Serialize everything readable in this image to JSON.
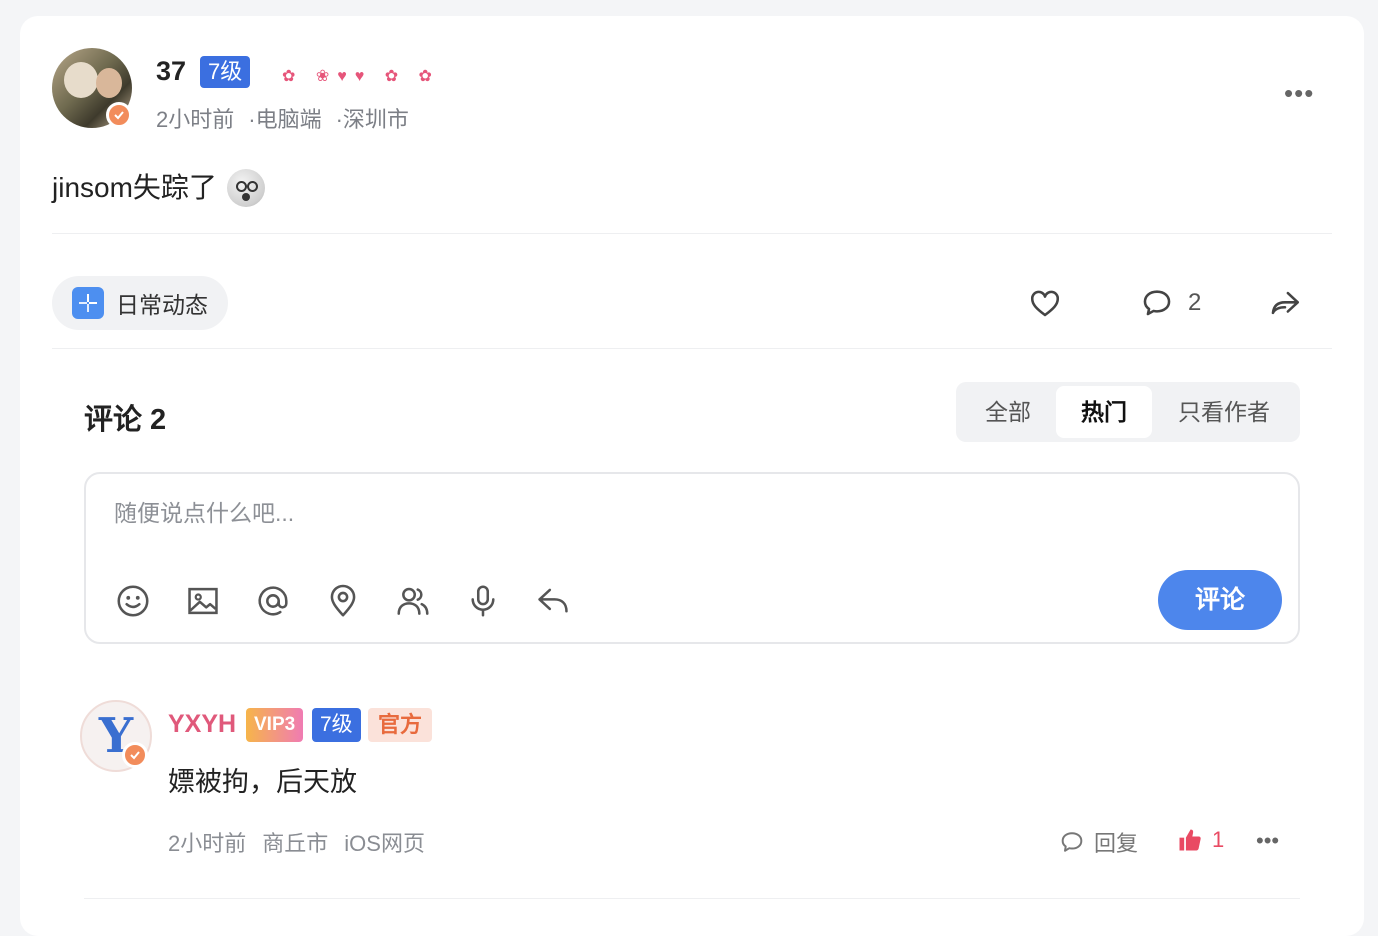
{
  "post": {
    "author": "37",
    "level": "7级",
    "decoration": "✿ ❀♥♥ ✿ ✿",
    "time": "2小时前",
    "device": "电脑端",
    "city": "深圳市",
    "separator": "·",
    "more": "•••",
    "content": "jinsom失踪了",
    "topic": "日常动态",
    "comment_count": "2"
  },
  "comments": {
    "title": "评论 2",
    "tabs": [
      "全部",
      "热门",
      "只看作者"
    ],
    "active_tab": "热门",
    "placeholder": "随便说点什么吧...",
    "submit": "评论",
    "toolbar_icons": [
      "emoji-icon",
      "image-icon",
      "at-icon",
      "location-icon",
      "users-icon",
      "microphone-icon",
      "reply-icon"
    ],
    "items": [
      {
        "avatar_letter": "Y",
        "name": "YXYH",
        "vip": "VIP3",
        "level": "7级",
        "badge": "官方",
        "text": "嫖被拘，后天放",
        "time": "2小时前",
        "city": "商丘市",
        "device": "iOS网页",
        "reply": "回复",
        "likes": "1",
        "more": "•••"
      }
    ]
  },
  "colors": {
    "accent": "#4d86ec",
    "level_badge": "#3b6fe0",
    "like_active": "#e94a63",
    "name_highlight": "#e0597b"
  }
}
